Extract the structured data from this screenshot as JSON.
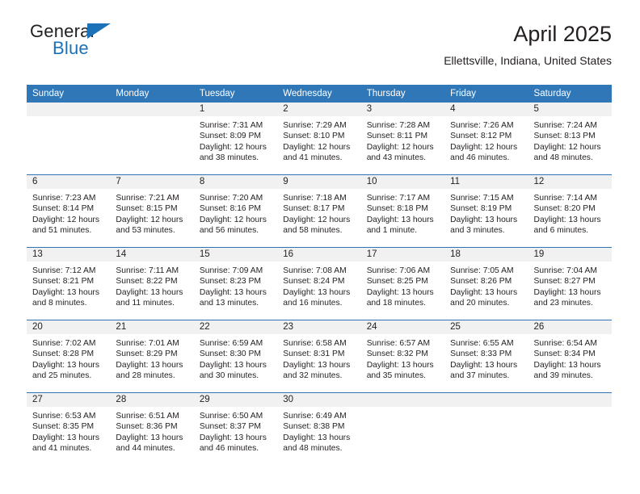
{
  "brand": {
    "word_top": "General",
    "word_bottom": "Blue",
    "accent_color": "#1c72b8"
  },
  "header": {
    "title": "April 2025",
    "subtitle": "Ellettsville, Indiana, United States"
  },
  "theme": {
    "header_blue": "#3077b8",
    "row_divider_blue": "#2e74b5",
    "daynum_band_gray": "#f1f1f1",
    "text_color": "#231f20"
  },
  "weekdays": [
    "Sunday",
    "Monday",
    "Tuesday",
    "Wednesday",
    "Thursday",
    "Friday",
    "Saturday"
  ],
  "weeks": [
    [
      {
        "day": "",
        "sunrise": "",
        "sunset": "",
        "daylight_line1": "",
        "daylight_line2": ""
      },
      {
        "day": "",
        "sunrise": "",
        "sunset": "",
        "daylight_line1": "",
        "daylight_line2": ""
      },
      {
        "day": "1",
        "sunrise": "Sunrise: 7:31 AM",
        "sunset": "Sunset: 8:09 PM",
        "daylight_line1": "Daylight: 12 hours",
        "daylight_line2": "and 38 minutes."
      },
      {
        "day": "2",
        "sunrise": "Sunrise: 7:29 AM",
        "sunset": "Sunset: 8:10 PM",
        "daylight_line1": "Daylight: 12 hours",
        "daylight_line2": "and 41 minutes."
      },
      {
        "day": "3",
        "sunrise": "Sunrise: 7:28 AM",
        "sunset": "Sunset: 8:11 PM",
        "daylight_line1": "Daylight: 12 hours",
        "daylight_line2": "and 43 minutes."
      },
      {
        "day": "4",
        "sunrise": "Sunrise: 7:26 AM",
        "sunset": "Sunset: 8:12 PM",
        "daylight_line1": "Daylight: 12 hours",
        "daylight_line2": "and 46 minutes."
      },
      {
        "day": "5",
        "sunrise": "Sunrise: 7:24 AM",
        "sunset": "Sunset: 8:13 PM",
        "daylight_line1": "Daylight: 12 hours",
        "daylight_line2": "and 48 minutes."
      }
    ],
    [
      {
        "day": "6",
        "sunrise": "Sunrise: 7:23 AM",
        "sunset": "Sunset: 8:14 PM",
        "daylight_line1": "Daylight: 12 hours",
        "daylight_line2": "and 51 minutes."
      },
      {
        "day": "7",
        "sunrise": "Sunrise: 7:21 AM",
        "sunset": "Sunset: 8:15 PM",
        "daylight_line1": "Daylight: 12 hours",
        "daylight_line2": "and 53 minutes."
      },
      {
        "day": "8",
        "sunrise": "Sunrise: 7:20 AM",
        "sunset": "Sunset: 8:16 PM",
        "daylight_line1": "Daylight: 12 hours",
        "daylight_line2": "and 56 minutes."
      },
      {
        "day": "9",
        "sunrise": "Sunrise: 7:18 AM",
        "sunset": "Sunset: 8:17 PM",
        "daylight_line1": "Daylight: 12 hours",
        "daylight_line2": "and 58 minutes."
      },
      {
        "day": "10",
        "sunrise": "Sunrise: 7:17 AM",
        "sunset": "Sunset: 8:18 PM",
        "daylight_line1": "Daylight: 13 hours",
        "daylight_line2": "and 1 minute."
      },
      {
        "day": "11",
        "sunrise": "Sunrise: 7:15 AM",
        "sunset": "Sunset: 8:19 PM",
        "daylight_line1": "Daylight: 13 hours",
        "daylight_line2": "and 3 minutes."
      },
      {
        "day": "12",
        "sunrise": "Sunrise: 7:14 AM",
        "sunset": "Sunset: 8:20 PM",
        "daylight_line1": "Daylight: 13 hours",
        "daylight_line2": "and 6 minutes."
      }
    ],
    [
      {
        "day": "13",
        "sunrise": "Sunrise: 7:12 AM",
        "sunset": "Sunset: 8:21 PM",
        "daylight_line1": "Daylight: 13 hours",
        "daylight_line2": "and 8 minutes."
      },
      {
        "day": "14",
        "sunrise": "Sunrise: 7:11 AM",
        "sunset": "Sunset: 8:22 PM",
        "daylight_line1": "Daylight: 13 hours",
        "daylight_line2": "and 11 minutes."
      },
      {
        "day": "15",
        "sunrise": "Sunrise: 7:09 AM",
        "sunset": "Sunset: 8:23 PM",
        "daylight_line1": "Daylight: 13 hours",
        "daylight_line2": "and 13 minutes."
      },
      {
        "day": "16",
        "sunrise": "Sunrise: 7:08 AM",
        "sunset": "Sunset: 8:24 PM",
        "daylight_line1": "Daylight: 13 hours",
        "daylight_line2": "and 16 minutes."
      },
      {
        "day": "17",
        "sunrise": "Sunrise: 7:06 AM",
        "sunset": "Sunset: 8:25 PM",
        "daylight_line1": "Daylight: 13 hours",
        "daylight_line2": "and 18 minutes."
      },
      {
        "day": "18",
        "sunrise": "Sunrise: 7:05 AM",
        "sunset": "Sunset: 8:26 PM",
        "daylight_line1": "Daylight: 13 hours",
        "daylight_line2": "and 20 minutes."
      },
      {
        "day": "19",
        "sunrise": "Sunrise: 7:04 AM",
        "sunset": "Sunset: 8:27 PM",
        "daylight_line1": "Daylight: 13 hours",
        "daylight_line2": "and 23 minutes."
      }
    ],
    [
      {
        "day": "20",
        "sunrise": "Sunrise: 7:02 AM",
        "sunset": "Sunset: 8:28 PM",
        "daylight_line1": "Daylight: 13 hours",
        "daylight_line2": "and 25 minutes."
      },
      {
        "day": "21",
        "sunrise": "Sunrise: 7:01 AM",
        "sunset": "Sunset: 8:29 PM",
        "daylight_line1": "Daylight: 13 hours",
        "daylight_line2": "and 28 minutes."
      },
      {
        "day": "22",
        "sunrise": "Sunrise: 6:59 AM",
        "sunset": "Sunset: 8:30 PM",
        "daylight_line1": "Daylight: 13 hours",
        "daylight_line2": "and 30 minutes."
      },
      {
        "day": "23",
        "sunrise": "Sunrise: 6:58 AM",
        "sunset": "Sunset: 8:31 PM",
        "daylight_line1": "Daylight: 13 hours",
        "daylight_line2": "and 32 minutes."
      },
      {
        "day": "24",
        "sunrise": "Sunrise: 6:57 AM",
        "sunset": "Sunset: 8:32 PM",
        "daylight_line1": "Daylight: 13 hours",
        "daylight_line2": "and 35 minutes."
      },
      {
        "day": "25",
        "sunrise": "Sunrise: 6:55 AM",
        "sunset": "Sunset: 8:33 PM",
        "daylight_line1": "Daylight: 13 hours",
        "daylight_line2": "and 37 minutes."
      },
      {
        "day": "26",
        "sunrise": "Sunrise: 6:54 AM",
        "sunset": "Sunset: 8:34 PM",
        "daylight_line1": "Daylight: 13 hours",
        "daylight_line2": "and 39 minutes."
      }
    ],
    [
      {
        "day": "27",
        "sunrise": "Sunrise: 6:53 AM",
        "sunset": "Sunset: 8:35 PM",
        "daylight_line1": "Daylight: 13 hours",
        "daylight_line2": "and 41 minutes."
      },
      {
        "day": "28",
        "sunrise": "Sunrise: 6:51 AM",
        "sunset": "Sunset: 8:36 PM",
        "daylight_line1": "Daylight: 13 hours",
        "daylight_line2": "and 44 minutes."
      },
      {
        "day": "29",
        "sunrise": "Sunrise: 6:50 AM",
        "sunset": "Sunset: 8:37 PM",
        "daylight_line1": "Daylight: 13 hours",
        "daylight_line2": "and 46 minutes."
      },
      {
        "day": "30",
        "sunrise": "Sunrise: 6:49 AM",
        "sunset": "Sunset: 8:38 PM",
        "daylight_line1": "Daylight: 13 hours",
        "daylight_line2": "and 48 minutes."
      },
      {
        "day": "",
        "sunrise": "",
        "sunset": "",
        "daylight_line1": "",
        "daylight_line2": ""
      },
      {
        "day": "",
        "sunrise": "",
        "sunset": "",
        "daylight_line1": "",
        "daylight_line2": ""
      },
      {
        "day": "",
        "sunrise": "",
        "sunset": "",
        "daylight_line1": "",
        "daylight_line2": ""
      }
    ]
  ]
}
